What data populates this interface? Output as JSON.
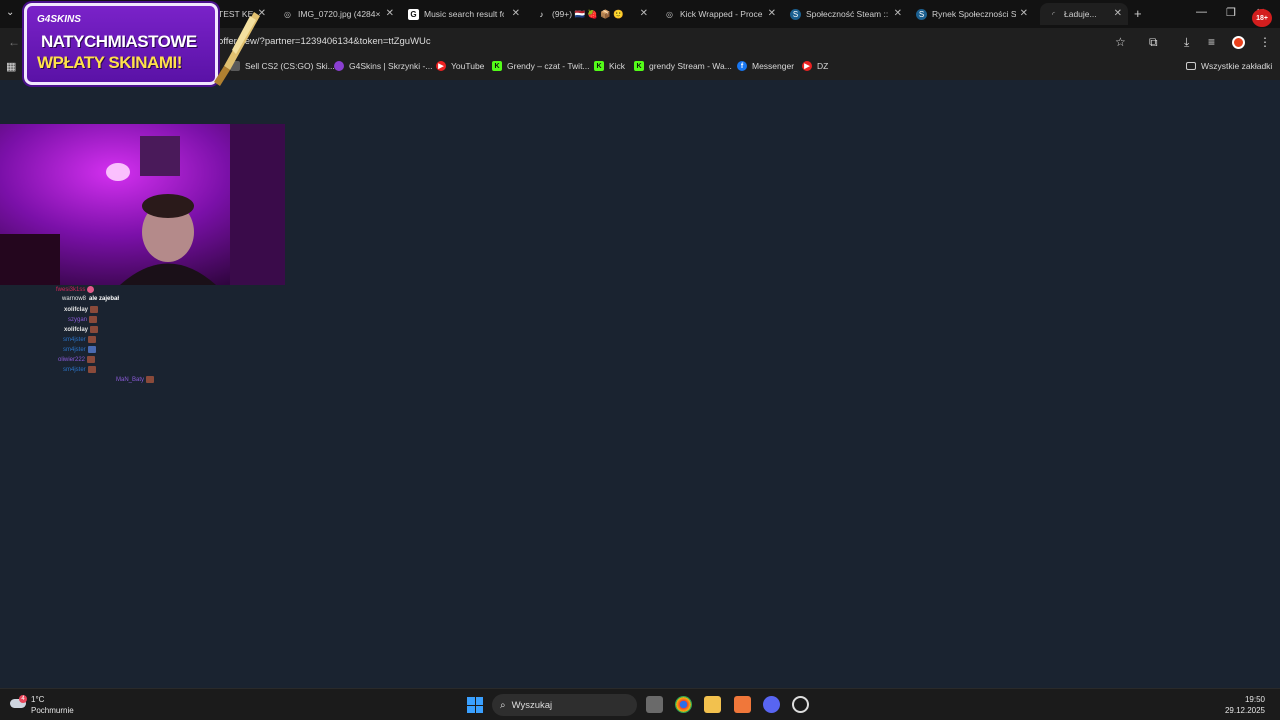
{
  "tabs": [
    {
      "label": "TEST KE",
      "icon": "page-icon"
    },
    {
      "label": "IMG_0720.jpg (4284×",
      "icon": "globe-icon"
    },
    {
      "label": "Music search result fo",
      "icon": "g-icon"
    },
    {
      "label": "(99+) 🇳🇱 🍓 📦 🙂",
      "icon": "tiktok-icon"
    },
    {
      "label": "Kick Wrapped - Proce",
      "icon": "globe-icon"
    },
    {
      "label": "Społeczność Steam :: ",
      "icon": "steam-icon"
    },
    {
      "label": "Rynek Społeczności St",
      "icon": "steam-icon"
    },
    {
      "label": "Ładuje...",
      "icon": "loading-icon"
    }
  ],
  "address": {
    "url": "offer/new/?partner=1239406134&token=ttZguWUc"
  },
  "bookmarks": [
    {
      "label": "Sell CS2 (CS:GO) Ski...",
      "icon": "cs2-icon",
      "color": "#5a5a5a"
    },
    {
      "label": "G4Skins | Skrzynki -...",
      "icon": "g4skins-icon",
      "color": "#8a3fd1"
    },
    {
      "label": "YouTube",
      "icon": "youtube-icon",
      "color": "#e22"
    },
    {
      "label": "Grendy – czat - Twit...",
      "icon": "kick-icon",
      "color": "#53fc18"
    },
    {
      "label": "Kick",
      "icon": "kick-icon",
      "color": "#53fc18"
    },
    {
      "label": "grendy Stream - Wa...",
      "icon": "kick-icon",
      "color": "#53fc18"
    },
    {
      "label": "Messenger",
      "icon": "facebook-icon",
      "color": "#1877f2"
    },
    {
      "label": "DZ",
      "icon": "youtube-icon",
      "color": "#e22"
    }
  ],
  "all_bookmarks": "Wszystkie zakładki",
  "promo": {
    "brand": "G4SKINS",
    "line1": "NATYCHMIASTOWE",
    "line2": "WPŁATY SKINAMI!"
  },
  "chat": [
    {
      "user": "fwesi3k1ss",
      "msg": "",
      "color": "#d4245a"
    },
    {
      "user": "warnow8",
      "msg": "ale zajebał",
      "color": "#e6e6e6"
    },
    {
      "user": "xolifclay",
      "msg": "",
      "color": "#e6e6e6"
    },
    {
      "user": "szygan",
      "msg": "",
      "color": "#8a5ad6"
    },
    {
      "user": "xolifclay",
      "msg": "",
      "color": "#e6e6e6"
    },
    {
      "user": "sm4jster",
      "msg": "",
      "color": "#2a72c4"
    },
    {
      "user": "sm4jster",
      "msg": "",
      "color": "#2a72c4"
    },
    {
      "user": "oliwier222",
      "msg": "",
      "color": "#8a5ad6"
    },
    {
      "user": "sm4jster",
      "msg": "",
      "color": "#2a72c4"
    },
    {
      "user": "MaN_Baty",
      "msg": "",
      "color": "#8a5ad6"
    }
  ],
  "taskbar": {
    "search": "Wyszukaj",
    "weather_temp": "1°C",
    "weather_desc": "Pochmurnie",
    "time": "19:50",
    "date": "29.12.2025"
  },
  "profile_badge": "18+"
}
